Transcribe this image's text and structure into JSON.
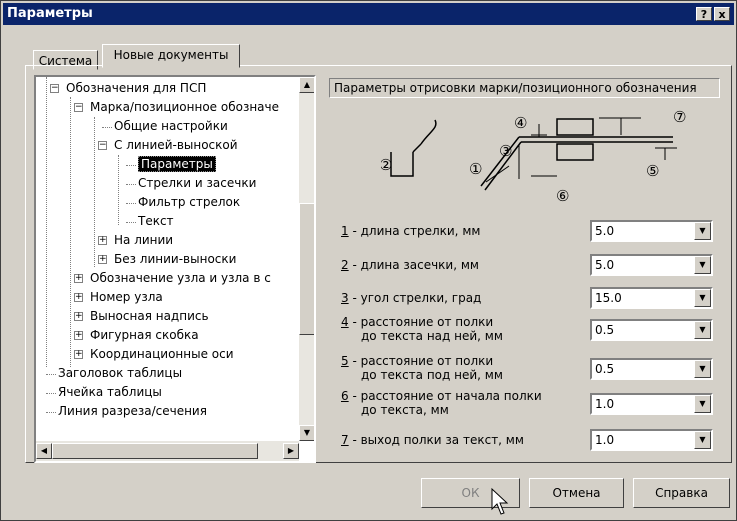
{
  "window": {
    "title": "Параметры",
    "help_btn": "?",
    "close_btn": "x"
  },
  "tabs": [
    "Система",
    "Новые документы"
  ],
  "tree": [
    "Обозначения для ПСП",
    "Марка/позиционное обозначе",
    "Общие настройки",
    "С линией-выноской",
    "Параметры",
    "Стрелки и засечки",
    "Фильтр стрелок",
    "Текст",
    "На линии",
    "Без линии-выноски",
    "Обозначение узла и узла в с",
    "Номер узла",
    "Выносная надпись",
    "Фигурная скобка",
    "Координационные оси",
    "Заголовок таблицы",
    "Ячейка таблицы",
    "Линия разреза/сечения"
  ],
  "panel": {
    "title": "Параметры отрисовки марки/позиционного обозначения",
    "diagram_labels": [
      "①",
      "②",
      "③",
      "④",
      "⑤",
      "⑥",
      "⑦"
    ]
  },
  "params": [
    {
      "num": "1",
      "text1": " - длина стрелки, мм",
      "text2": "",
      "value": "5.0"
    },
    {
      "num": "2",
      "text1": " - длина засечки, мм",
      "text2": "",
      "value": "5.0"
    },
    {
      "num": "3",
      "text1": " - угол стрелки, град",
      "text2": "",
      "value": "15.0"
    },
    {
      "num": "4",
      "text1": " - расстояние от полки",
      "text2": "до текста над ней, мм",
      "value": "0.5"
    },
    {
      "num": "5",
      "text1": " - расстояние от полки",
      "text2": "до текста под ней, мм",
      "value": "0.5"
    },
    {
      "num": "6",
      "text1": " - расстояние от начала полки",
      "text2": "до текста, мм",
      "value": "1.0"
    },
    {
      "num": "7",
      "text1": " - выход полки за текст, мм",
      "text2": "",
      "value": "1.0"
    }
  ],
  "buttons": {
    "ok": "ОК",
    "cancel": "Отмена",
    "help": "Справка"
  }
}
